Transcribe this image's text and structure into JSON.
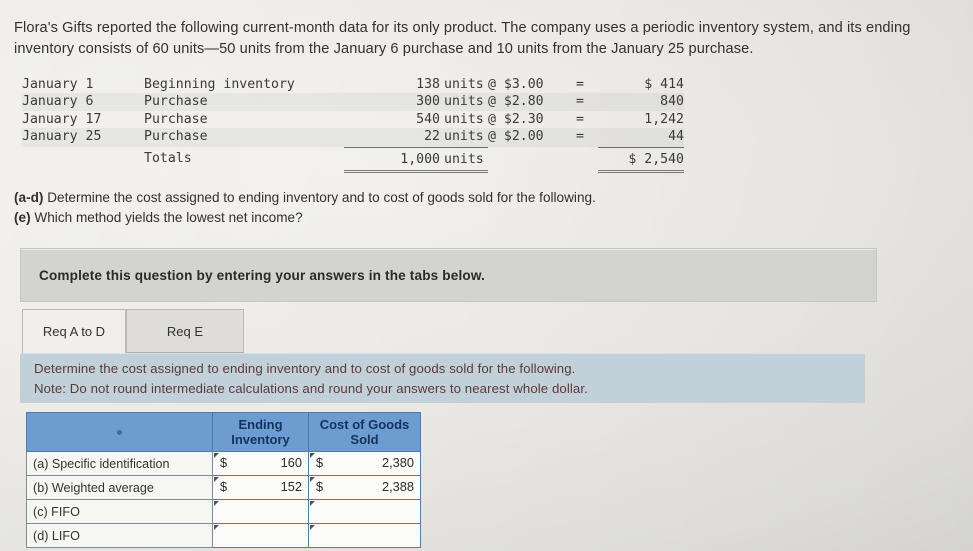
{
  "intro": "Flora's Gifts reported the following current-month data for its only product. The company uses a periodic inventory system, and its ending inventory consists of 60 units—50 units from the January 6 purchase and 10 units from the January 25 purchase.",
  "inventory_table": {
    "rows": [
      {
        "date": "January 1",
        "description": "Beginning inventory",
        "units": "138",
        "units_label": "units",
        "price": "@ $3.00",
        "eq": "=",
        "amount": "$ 414"
      },
      {
        "date": "January 6",
        "description": "Purchase",
        "units": "300",
        "units_label": "units",
        "price": "@ $2.80",
        "eq": "=",
        "amount": "840"
      },
      {
        "date": "January 17",
        "description": "Purchase",
        "units": "540",
        "units_label": "units",
        "price": "@ $2.30",
        "eq": "=",
        "amount": "1,242"
      },
      {
        "date": "January 25",
        "description": "Purchase",
        "units": "22",
        "units_label": "units",
        "price": "@ $2.00",
        "eq": "=",
        "amount": "44"
      }
    ],
    "totals": {
      "date": "",
      "description": "Totals",
      "units": "1,000",
      "units_label": "units",
      "price": "",
      "eq": "",
      "amount": "$ 2,540"
    }
  },
  "requirements": {
    "line1_bold": "(a-d)",
    "line1_text": " Determine the cost assigned to ending inventory and to cost of goods sold for the following.",
    "line2_bold": "(e)",
    "line2_text": " Which method yields the lowest net income?"
  },
  "banner": {
    "text": "Complete this question by entering your answers in the tabs below."
  },
  "tabs": [
    {
      "label": "Req A to D",
      "active": true
    },
    {
      "label": "Req E",
      "active": false
    }
  ],
  "blue_band": {
    "line1": "Determine the cost assigned to ending inventory and to cost of goods sold for the following.",
    "line2": "Note: Do not round intermediate calculations and round your answers to nearest whole dollar."
  },
  "answer_grid": {
    "headers": {
      "blank": "",
      "ending_inventory": "Ending\nInventory",
      "ending_inventory_l1": "Ending",
      "ending_inventory_l2": "Inventory",
      "cogs_l1": "Cost of Goods",
      "cogs_l2": "Sold"
    },
    "rows": [
      {
        "label": "(a) Specific identification",
        "ei_symbol": "$",
        "ei_value": "160",
        "cogs_symbol": "$",
        "cogs_value": "2,380"
      },
      {
        "label": "(b) Weighted average",
        "ei_symbol": "$",
        "ei_value": "152",
        "cogs_symbol": "$",
        "cogs_value": "2,388"
      },
      {
        "label": "(c) FIFO",
        "ei_symbol": "",
        "ei_value": "",
        "cogs_symbol": "",
        "cogs_value": ""
      },
      {
        "label": "(d) LIFO",
        "ei_symbol": "",
        "ei_value": "",
        "cogs_symbol": "",
        "cogs_value": ""
      }
    ]
  },
  "colors": {
    "header_blue": "#6d9dd0",
    "band_blue": "#c2d0da",
    "banner_gray": "#d3d3d0",
    "page": "#eceae6"
  }
}
